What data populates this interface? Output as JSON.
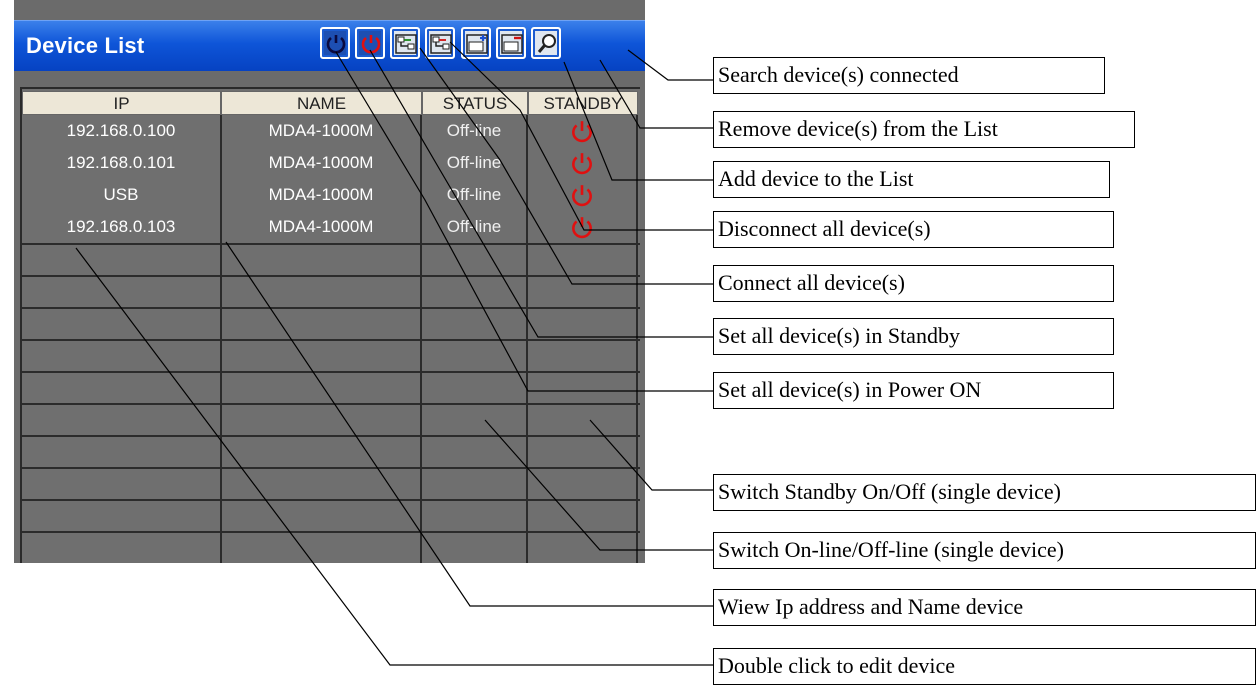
{
  "window": {
    "title": "Device List"
  },
  "toolbar": [
    {
      "name": "power-on-all-button",
      "icon": "power-blue-icon"
    },
    {
      "name": "standby-all-button",
      "icon": "power-red-icon"
    },
    {
      "name": "connect-all-button",
      "icon": "connect-icon"
    },
    {
      "name": "disconnect-all-button",
      "icon": "disconnect-icon"
    },
    {
      "name": "add-device-button",
      "icon": "add-device-icon"
    },
    {
      "name": "remove-device-button",
      "icon": "remove-device-icon"
    },
    {
      "name": "search-device-button",
      "icon": "search-icon"
    }
  ],
  "table": {
    "columns": [
      "IP",
      "NAME",
      "STATUS",
      "STANDBY"
    ],
    "rows": [
      {
        "ip": "192.168.0.100",
        "name": "MDA4-1000M",
        "status": "Off-line",
        "standby_icon": "power-red-icon"
      },
      {
        "ip": "192.168.0.101",
        "name": "MDA4-1000M",
        "status": "Off-line",
        "standby_icon": "power-red-icon"
      },
      {
        "ip": "USB",
        "name": "MDA4-1000M",
        "status": "Off-line",
        "standby_icon": "power-red-icon"
      },
      {
        "ip": "192.168.0.103",
        "name": "MDA4-1000M",
        "status": "Off-line",
        "standby_icon": "power-red-icon"
      }
    ]
  },
  "callouts": {
    "search": "Search device(s) connected",
    "remove": "Remove device(s) from the List",
    "add": "Add device to the List",
    "disconnect": "Disconnect all device(s)",
    "connect": "Connect all device(s)",
    "standby_all": "Set all device(s) in Standby",
    "power_on_all": "Set all device(s) in Power ON",
    "switch_standby": "Switch Standby On/Off (single device)",
    "switch_online": "Switch On-line/Off-line (single device)",
    "view_ip": "Wiew Ip address and Name device",
    "edit_device": "Double click to edit device"
  },
  "colors": {
    "title_bar": "#0e55d8",
    "grid_bg": "#6f6f6f",
    "header_bg": "#ede7d7",
    "power_red": "#e01010",
    "power_blue": "#1a4fb0"
  }
}
